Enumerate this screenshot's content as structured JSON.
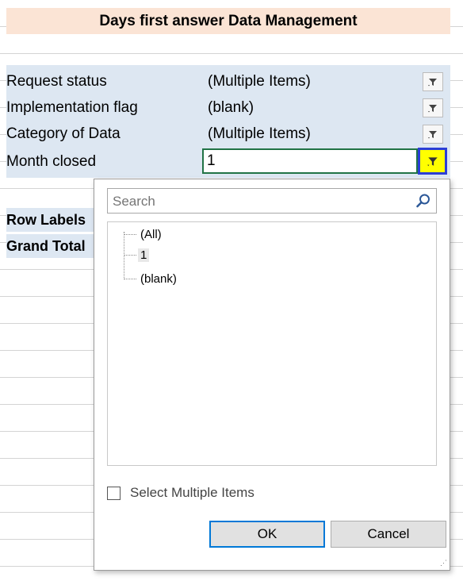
{
  "sheet": {
    "title": "Days first answer Data Management",
    "filters": [
      {
        "label": "Request status",
        "value": "(Multiple Items)"
      },
      {
        "label": "Implementation flag",
        "value": "(blank)"
      },
      {
        "label": "Category of Data",
        "value": "(Multiple Items)"
      },
      {
        "label": "Month closed",
        "value": "1"
      }
    ],
    "pivot": {
      "row_labels": "Row Labels",
      "grand_total": "Grand Total"
    }
  },
  "dropdown": {
    "search_placeholder": "Search",
    "items": [
      {
        "label": "(All)",
        "selected": false
      },
      {
        "label": "1",
        "selected": true
      },
      {
        "label": "(blank)",
        "selected": false
      }
    ],
    "select_multiple_label": "Select Multiple Items",
    "ok_label": "OK",
    "cancel_label": "Cancel"
  },
  "colors": {
    "title_fill": "#fbe4d5",
    "filter_fill": "#dde7f2",
    "active_filter_fill": "#ffff00",
    "active_filter_border": "#2b3ed6",
    "cell_selection": "#217346",
    "ok_focus": "#0078d7"
  },
  "icons": {
    "filter_button": "funnel-filter-icon",
    "search": "magnifier-search-icon"
  }
}
